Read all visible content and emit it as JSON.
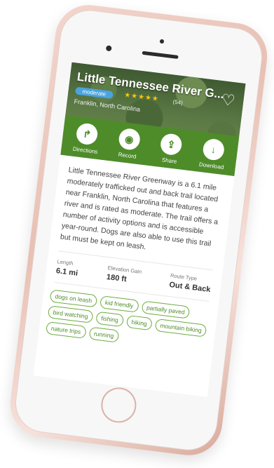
{
  "trail": {
    "title": "Little Tennessee River G...",
    "difficulty": "moderate",
    "stars": "★★★★★",
    "review_count": "(54)",
    "location": "Franklin, North Carolina"
  },
  "actions": [
    {
      "label": "Directions",
      "icon": "↱"
    },
    {
      "label": "Record",
      "icon": "◉"
    },
    {
      "label": "Share",
      "icon": "⇪"
    },
    {
      "label": "Download",
      "icon": "↓"
    }
  ],
  "description": "Little Tennessee River Greenway is a 6.1 mile moderately trafficked out and back trail located near Franklin, North Carolina that features a river and is rated as moderate. The trail offers a number of activity options and is accessible year-round. Dogs are also able to use this trail but must be kept on leash.",
  "stats": {
    "length_label": "Length",
    "length_value": "6.1 mi",
    "elevation_label": "Elevation Gain",
    "elevation_value": "180 ft",
    "route_label": "Route Type",
    "route_value": "Out & Back"
  },
  "tags": [
    "dogs on leash",
    "kid friendly",
    "partially paved",
    "bird watching",
    "fishing",
    "hiking",
    "mountain biking",
    "nature trips",
    "running"
  ],
  "colors": {
    "accent_green": "#4e8c2a",
    "badge_blue": "#4aa3df",
    "star_yellow": "#f5c518"
  }
}
